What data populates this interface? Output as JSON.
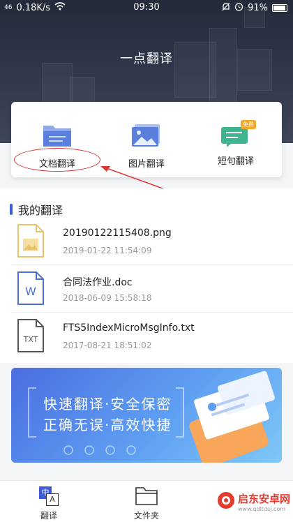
{
  "status_bar": {
    "signal": "46",
    "speed": "0.18K/s",
    "time": "09:30",
    "battery": "91%"
  },
  "app": {
    "title": "一点翻译"
  },
  "features": [
    {
      "label": "文档翻译",
      "icon": "folder-icon"
    },
    {
      "label": "图片翻译",
      "icon": "image-icon"
    },
    {
      "label": "短句翻译",
      "icon": "chat-icon",
      "badge": "免费"
    }
  ],
  "my_translations": {
    "title": "我的翻译",
    "files": [
      {
        "name": "20190122115408.png",
        "date": "2019-01-22 11:54:09",
        "icon": "image-file-icon"
      },
      {
        "name": "合同法作业.doc",
        "date": "2018-06-09 15:58:18",
        "icon": "word-file-icon",
        "icon_text": "W"
      },
      {
        "name": "FTS5IndexMicroMsgInfo.txt",
        "date": "2017-08-21 18:51:02",
        "icon": "txt-file-icon",
        "icon_text": "TXT"
      }
    ]
  },
  "banner": {
    "line1": "快速翻译·安全保密",
    "line2": "正确无误·高效快捷"
  },
  "bottom_nav": [
    {
      "label": "翻译",
      "icon": "translate-icon",
      "icon_text_a": "中",
      "icon_text_b": "A"
    },
    {
      "label": "文件夹",
      "icon": "folder-outline-icon"
    }
  ],
  "watermark": {
    "title": "启东安卓网",
    "url": "www.qdltdsj.com"
  },
  "colors": {
    "accent": "#3d5bd6",
    "hero": "#2c3244",
    "annotation": "#d33333"
  }
}
